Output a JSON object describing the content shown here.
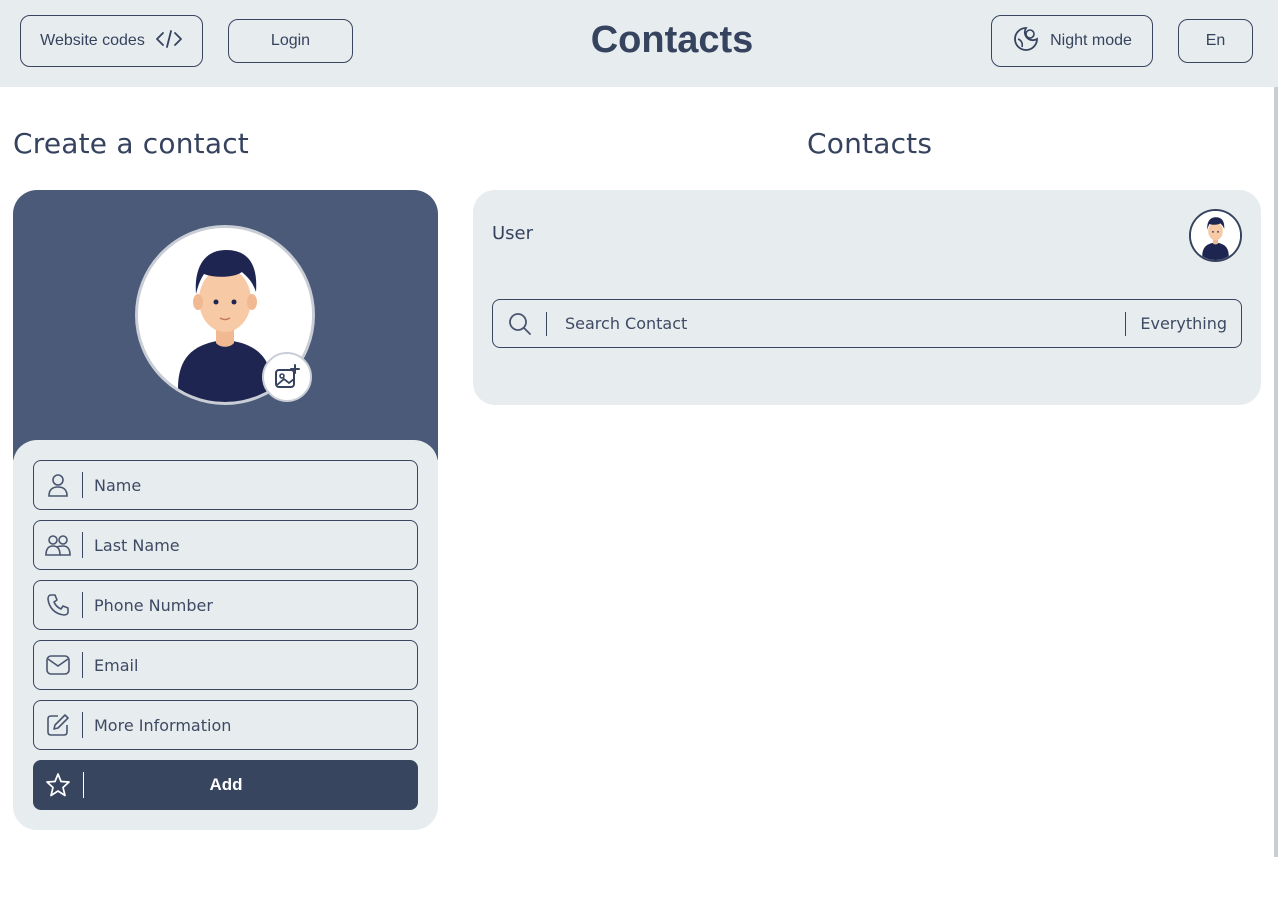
{
  "header": {
    "website_codes_label": "Website codes",
    "login_label": "Login",
    "title": "Contacts",
    "night_mode_label": "Night mode",
    "language_label": "En"
  },
  "create": {
    "heading": "Create a contact",
    "fields": [
      {
        "label": "Name",
        "icon": "user-icon"
      },
      {
        "label": "Last Name",
        "icon": "users-icon"
      },
      {
        "label": "Phone Number",
        "icon": "phone-icon"
      },
      {
        "label": "Email",
        "icon": "mail-icon"
      },
      {
        "label": "More Information",
        "icon": "edit-icon"
      }
    ],
    "add_label": "Add"
  },
  "contacts": {
    "heading": "Contacts",
    "user_label": "User",
    "search": {
      "placeholder": "Search Contact",
      "filter": "Everything"
    }
  },
  "colors": {
    "primary": "#36435f",
    "panel": "#e7ecee",
    "card_top": "#4a5a78"
  }
}
